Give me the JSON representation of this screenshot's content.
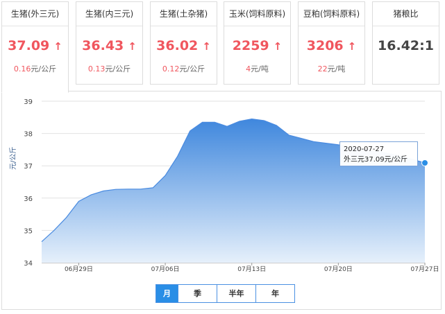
{
  "cards": [
    {
      "title": "生猪(外三元)",
      "price": "37.09",
      "arrow": "↑",
      "change": "0.16",
      "unit": "元/公斤"
    },
    {
      "title": "生猪(内三元)",
      "price": "36.43",
      "arrow": "↑",
      "change": "0.13",
      "unit": "元/公斤"
    },
    {
      "title": "生猪(土杂猪)",
      "price": "36.02",
      "arrow": "↑",
      "change": "0.12",
      "unit": "元/公斤"
    },
    {
      "title": "玉米(饲料原料)",
      "price": "2259",
      "arrow": "↑",
      "change": "4",
      "unit": "元/吨"
    },
    {
      "title": "豆粕(饲料原料)",
      "price": "3206",
      "arrow": "↑",
      "change": "22",
      "unit": "元/吨"
    },
    {
      "title": "猪粮比",
      "price": "16.42:1"
    }
  ],
  "colors": {
    "up": "#f0565e",
    "area_top": "#3f87dd",
    "area_bottom": "#e6f0fb",
    "line": "#4a8be0",
    "accent": "#2a8ee6"
  },
  "chart": {
    "ylabel": "元/公斤",
    "tooltip": {
      "date": "2020-07-27",
      "text": "外三元37.09元/公斤"
    },
    "ranges": [
      "月",
      "季",
      "半年",
      "年"
    ],
    "active_range": "月"
  },
  "chart_data": {
    "type": "area",
    "ylim": [
      34,
      39
    ],
    "yticks": [
      34,
      35,
      36,
      37,
      38,
      39
    ],
    "xticks": [
      "06月29日",
      "07月06日",
      "07月13日",
      "07月20日",
      "07月27日"
    ],
    "grid": true,
    "legend": "none",
    "x": [
      "06-26",
      "06-27",
      "06-28",
      "06-29",
      "06-30",
      "07-01",
      "07-02",
      "07-03",
      "07-04",
      "07-05",
      "07-06",
      "07-07",
      "07-08",
      "07-09",
      "07-10",
      "07-11",
      "07-12",
      "07-13",
      "07-14",
      "07-15",
      "07-16",
      "07-17",
      "07-18",
      "07-19",
      "07-20",
      "07-21",
      "07-22",
      "07-23",
      "07-24",
      "07-25",
      "07-26",
      "07-27"
    ],
    "values": [
      34.65,
      35.0,
      35.4,
      35.9,
      36.1,
      36.22,
      36.27,
      36.28,
      36.28,
      36.32,
      36.7,
      37.3,
      38.08,
      38.35,
      38.35,
      38.22,
      38.38,
      38.45,
      38.4,
      38.25,
      37.95,
      37.85,
      37.75,
      37.7,
      37.65,
      37.58,
      37.52,
      37.45,
      37.38,
      37.3,
      37.2,
      37.09
    ]
  }
}
